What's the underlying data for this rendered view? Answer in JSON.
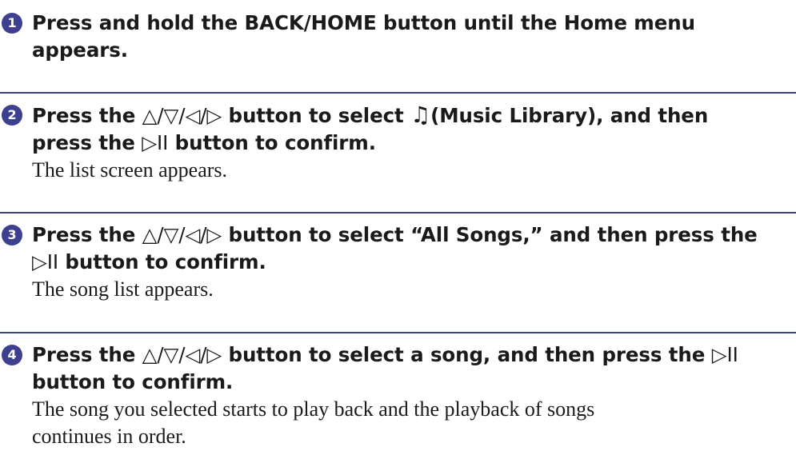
{
  "steps": [
    {
      "number": "1",
      "head_lines": [
        [
          "Press and hold the BACK/HOME button until the Home menu"
        ],
        [
          "appears."
        ]
      ],
      "desc_lines": []
    },
    {
      "number": "2",
      "head": {
        "p1": "Press the ",
        "arrows": "△/▽/◁/▷",
        "p2": " button to select ",
        "music_icon": "♫",
        "p3": "(Music Library), and then",
        "line2_a": "press the ",
        "play_pause": "▷II",
        "line2_b": " button to confirm."
      },
      "desc_lines": [
        "The list screen appears."
      ]
    },
    {
      "number": "3",
      "head": {
        "p1": "Press the ",
        "arrows": "△/▽/◁/▷",
        "p2": " button to select “All Songs,” and then press the",
        "play_pause": "▷II",
        "line2_b": " button to confirm."
      },
      "desc_lines": [
        "The song list appears."
      ]
    },
    {
      "number": "4",
      "head": {
        "p1": "Press the ",
        "arrows": "△/▽/◁/▷",
        "p2": " button to select a song, and then press the ",
        "play_pause": "▷II",
        "line2_b": "button to confirm."
      },
      "desc_lines": [
        "The song you selected starts to play back and the playback of songs",
        "continues in order."
      ]
    }
  ],
  "colors": {
    "accent": "#3d3f8f",
    "text": "#1a1a1a"
  }
}
